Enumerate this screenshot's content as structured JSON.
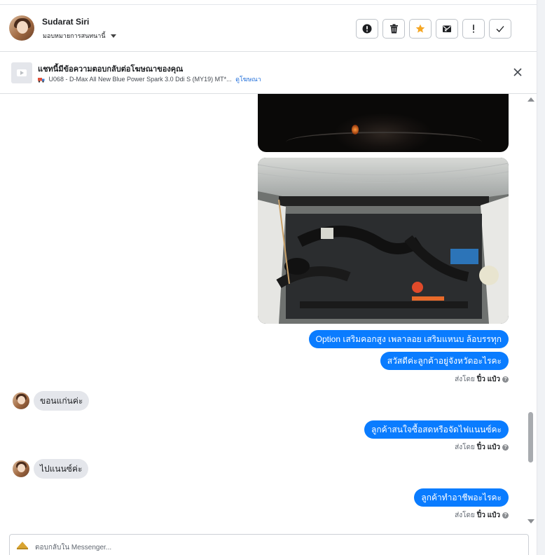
{
  "header": {
    "contact_name": "Sudarat Siri",
    "assign_label": "มอบหมายการสนทนานี้",
    "icons": [
      "exclamation-circle-icon",
      "trash-icon",
      "star-icon",
      "mail-x-icon",
      "exclamation-icon",
      "check-icon"
    ],
    "star_color": "#f5a623"
  },
  "ad_banner": {
    "title": "แชทนี้มีข้อความตอบกลับต่อโฆษณาของคุณ",
    "ad_text": "U068 - D-Max All New Blue Power Spark 3.0 Ddi S (MY19) MT*...",
    "link_label": "ดูโฆษณา",
    "link_color": "#216fdb"
  },
  "thread": {
    "images": [
      "car-interior-dark-photo",
      "engine-bay-photo"
    ],
    "messages": {
      "m1": "Option เสริมคอกสูง เพลาลอย เสริมแหนบ ล้อบรรทุก",
      "m2": "สวัสดีค่ะลูกค้าอยู่จังหวัดอะไรคะ",
      "m3": "ขอนแก่นค่ะ",
      "m4": "ลูกค้าสนใจซื้อสดหรือจัดไฟแนนซ์คะ",
      "m5": "ไปแนนซ์ค่ะ",
      "m6": "ลูกค้าทำอาชีพอะไรคะ"
    },
    "sent_by_prefix": "ส่งโดย",
    "sent_by_name": "ปิ๋ว แป๋ว",
    "help_mark": "?",
    "outgoing_color": "#0a7cff",
    "incoming_color": "#e4e6eb"
  },
  "composer": {
    "placeholder": "ตอบกลับใน Messenger..."
  }
}
